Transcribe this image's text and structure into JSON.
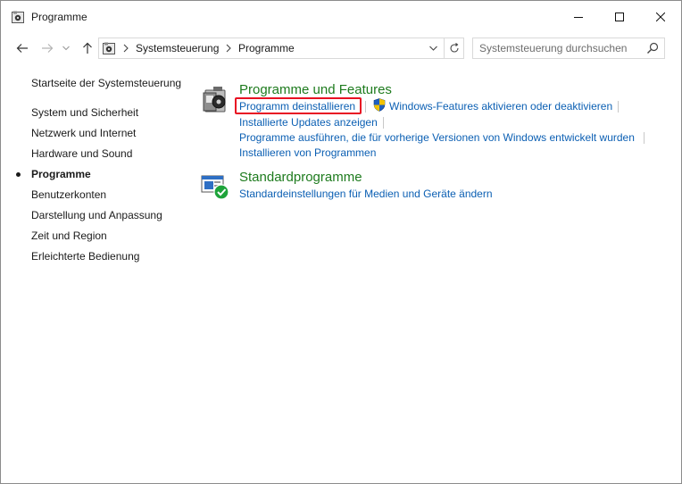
{
  "window": {
    "title": "Programme",
    "controls": {
      "minimize": "minimize-icon",
      "maximize": "maximize-icon",
      "close": "close-icon"
    }
  },
  "nav": {
    "back": "arrow-left-icon",
    "forward": "arrow-right-icon",
    "recent": "chevron-down-icon",
    "up": "arrow-up-icon",
    "breadcrumbs": [
      "Systemsteuerung",
      "Programme"
    ],
    "search_placeholder": "Systemsteuerung durchsuchen"
  },
  "sidebar": {
    "home": "Startseite der Systemsteuerung",
    "items": [
      {
        "label": "System und Sicherheit",
        "active": false
      },
      {
        "label": "Netzwerk und Internet",
        "active": false
      },
      {
        "label": "Hardware und Sound",
        "active": false
      },
      {
        "label": "Programme",
        "active": true
      },
      {
        "label": "Benutzerkonten",
        "active": false
      },
      {
        "label": "Darstellung und Anpassung",
        "active": false
      },
      {
        "label": "Zeit und Region",
        "active": false
      },
      {
        "label": "Erleichterte Bedienung",
        "active": false
      }
    ]
  },
  "main": {
    "programs_features": {
      "title": "Programme und Features",
      "links": {
        "uninstall": "Programm deinstallieren",
        "windows_features": "Windows-Features aktivieren oder deaktivieren",
        "installed_updates": "Installierte Updates anzeigen",
        "compat": "Programme ausführen, die für vorherige Versionen von Windows entwickelt wurden",
        "install_from_network": "Installieren von Programmen"
      }
    },
    "default_programs": {
      "title": "Standardprogramme",
      "links": {
        "autoplay": "Standardeinstellungen für Medien und Geräte ändern"
      }
    }
  },
  "colors": {
    "link": "#0b5fb3",
    "category_title": "#1e7b1e",
    "highlight": "#e81123"
  }
}
